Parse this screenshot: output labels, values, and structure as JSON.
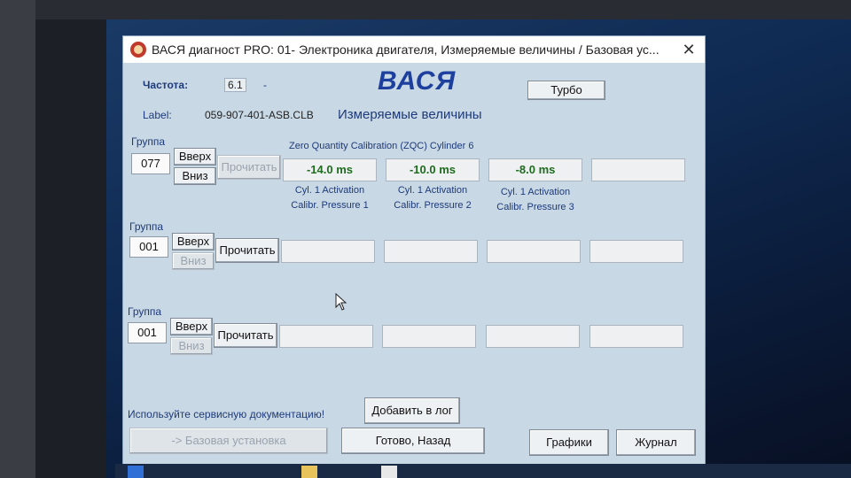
{
  "window": {
    "title": "ВАСЯ диагност PRO: 01- Электроника двигателя,  Измеряемые величины / Базовая ус...",
    "close_glyph": "✕"
  },
  "header": {
    "frequency_label": "Частота:",
    "frequency_value": "6.1",
    "frequency_suffix": "-",
    "brand": "ВАСЯ",
    "turbo_button": "Турбо",
    "label_caption": "Label:",
    "label_value": "059-907-401-ASB.CLB",
    "mode_title": "Измеряемые величины"
  },
  "groups": [
    {
      "caption": "Группа",
      "number": "077",
      "up_label": "Вверх",
      "down_label": "Вниз",
      "read_label": "Прочитать",
      "up_enabled": true,
      "down_enabled": true,
      "read_enabled": false,
      "description": "Zero Quantity Calibration (ZQC) Cylinder 6",
      "cells": [
        {
          "value": "-14.0 ms",
          "label1": "Cyl. 1 Activation",
          "label2": "Calibr. Pressure 1"
        },
        {
          "value": "-10.0 ms",
          "label1": "Cyl. 1 Activation",
          "label2": "Calibr. Pressure 2"
        },
        {
          "value": "-8.0 ms",
          "label1": "Cyl. 1 Activation",
          "label2": "Calibr. Pressure 3"
        },
        {
          "value": "",
          "label1": "",
          "label2": ""
        }
      ]
    },
    {
      "caption": "Группа",
      "number": "001",
      "up_label": "Вверх",
      "down_label": "Вниз",
      "read_label": "Прочитать",
      "up_enabled": true,
      "down_enabled": false,
      "read_enabled": true,
      "description": "",
      "cells": [
        {
          "value": ""
        },
        {
          "value": ""
        },
        {
          "value": ""
        },
        {
          "value": ""
        }
      ]
    },
    {
      "caption": "Группа",
      "number": "001",
      "up_label": "Вверх",
      "down_label": "Вниз",
      "read_label": "Прочитать",
      "up_enabled": true,
      "down_enabled": false,
      "read_enabled": true,
      "description": "",
      "cells": [
        {
          "value": ""
        },
        {
          "value": ""
        },
        {
          "value": ""
        },
        {
          "value": ""
        }
      ]
    }
  ],
  "footer": {
    "hint": "Используйте сервисную документацию!",
    "add_log": "Добавить в лог",
    "basic_setting": "-> Базовая установка",
    "done_back": "Готово, Назад",
    "graphs": "Графики",
    "journal": "Журнал"
  },
  "colors": {
    "value_green": "#1f6b1f",
    "label_blue": "#1d3a7a",
    "brand_blue": "#1d3f9e"
  }
}
